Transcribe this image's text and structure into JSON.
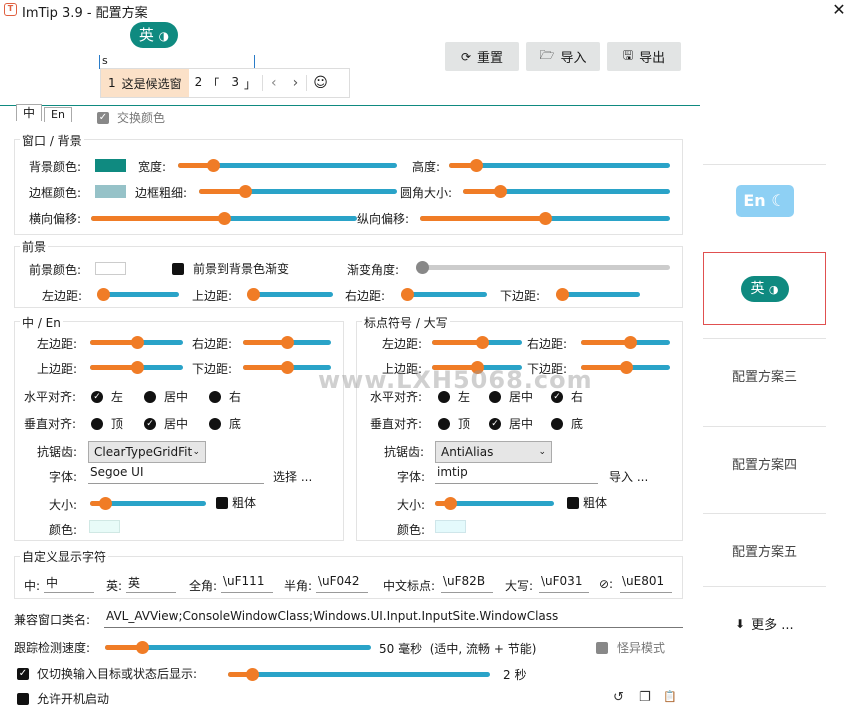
{
  "window": {
    "title": "ImTip 3.9 - 配置方案",
    "close": "✕",
    "app_icon": "T"
  },
  "preview": {
    "pill_text": "英",
    "pill_icon": "◑",
    "input_value": "s",
    "candidates": [
      {
        "num": "1",
        "text": "这是候选窗"
      },
      {
        "num": "2",
        "text": "「"
      },
      {
        "num": "3",
        "text": "」"
      }
    ],
    "prev": "‹",
    "next": "›",
    "emoji": "☺"
  },
  "toolbar": {
    "reset": "重置",
    "import": "导入",
    "export": "导出"
  },
  "tabs": {
    "cn": "中",
    "en": "En"
  },
  "swap_colors": "交换颜色",
  "window_bg": {
    "title": "窗口 / 背景",
    "bg_color": "背景颜色:",
    "width": "宽度:",
    "height": "高度:",
    "border_color": "边框颜色:",
    "border_width": "边框粗细:",
    "radius": "圆角大小:",
    "h_offset": "横向偏移:",
    "v_offset": "纵向偏移:",
    "bg_color_value": "#0f8a80",
    "border_color_value": "#96c2c8",
    "width_level": 0.16,
    "height_level": 0.12,
    "border_width_level": 0.23,
    "radius_level": 0.18,
    "h_offset_level": 0.5,
    "v_offset_level": 0.5
  },
  "foreground": {
    "title": "前景",
    "fg_color": "前景颜色:",
    "gradient": "前景到背景色渐变",
    "grad_angle": "渐变角度:",
    "left": "左边距:",
    "top": "上边距:",
    "right": "右边距:",
    "bottom": "下边距:",
    "left_level": 0.0,
    "top_level": 0.0,
    "right_level": 0.0,
    "bottom_level": 0.0,
    "angle_level": 0.0
  },
  "cn_en": {
    "title": "中 / En",
    "left": "左边距:",
    "right": "右边距:",
    "top": "上边距:",
    "bottom": "下边距:",
    "h_align": "水平对齐:",
    "left_opt": "左",
    "center_opt": "居中",
    "right_opt": "右",
    "v_align": "垂直对齐:",
    "top_opt": "顶",
    "middle_opt": "居中",
    "bottom_opt": "底",
    "antialias": "抗锯齿:",
    "antialias_value": "ClearTypeGridFit",
    "font": "字体:",
    "font_value": "Segoe UI",
    "choose": "选择 ...",
    "size": "大小:",
    "bold": "粗体",
    "color": "颜色:",
    "left_level": 0.5,
    "right_level": 0.5,
    "top_level": 0.5,
    "bottom_level": 0.5,
    "size_level": 0.13
  },
  "punct": {
    "title": "标点符号 / 大写",
    "left": "左边距:",
    "right": "右边距:",
    "top": "上边距:",
    "bottom": "下边距:",
    "h_align": "水平对齐:",
    "left_opt": "左",
    "center_opt": "居中",
    "right_opt": "右",
    "v_align": "垂直对齐:",
    "top_opt": "顶",
    "middle_opt": "居中",
    "bottom_opt": "底",
    "antialias": "抗锯齿:",
    "antialias_value": "AntiAlias",
    "font": "字体:",
    "font_value": "imtip",
    "import": "导入 ...",
    "size": "大小:",
    "bold": "粗体",
    "color": "颜色:",
    "left_level": 0.55,
    "right_level": 0.55,
    "top_level": 0.5,
    "bottom_level": 0.5,
    "size_level": 0.13
  },
  "custom": {
    "title": "自定义显示字符",
    "items": [
      {
        "label": "中:",
        "value": "中"
      },
      {
        "label": "英:",
        "value": "英"
      },
      {
        "label": "全角:",
        "value": "\\uF111"
      },
      {
        "label": "半角:",
        "value": "\\uF042"
      },
      {
        "label": "中文标点:",
        "value": "\\uF82B"
      },
      {
        "label": "大写:",
        "value": "\\uF031"
      },
      {
        "label": "⊘:",
        "value": "\\uE801"
      }
    ]
  },
  "compat": {
    "label": "兼容窗口类名:",
    "value": "AVL_AVView;ConsoleWindowClass;Windows.UI.Input.InputSite.WindowClass"
  },
  "tracking": {
    "label": "跟踪检测速度:",
    "value_text": "50 毫秒  (适中, 流畅 + 节能)",
    "level": 0.14,
    "quirk": "怪异模式"
  },
  "switch_only": {
    "label": "仅切换输入目标或状态后显示:",
    "value_text": "2 秒",
    "level": 0.09
  },
  "autostart": {
    "label": "允许开机启动"
  },
  "sidebar": {
    "items": [
      {
        "label": "En",
        "icon": "☾"
      },
      {
        "label": "英",
        "icon": "◑"
      },
      {
        "label": "配置方案三"
      },
      {
        "label": "配置方案四"
      },
      {
        "label": "配置方案五"
      }
    ],
    "more": "更多 ..."
  },
  "footer_icons": {
    "undo": "↺",
    "copy": "❐",
    "paste": "📋"
  },
  "watermark": "www.LXH5068.com"
}
